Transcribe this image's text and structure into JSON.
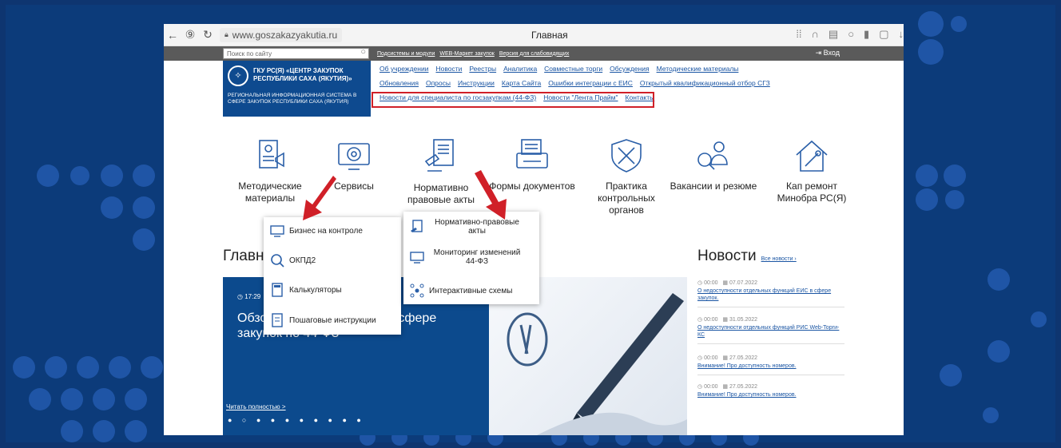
{
  "browser": {
    "url": "www.goszakazyakutia.ru",
    "page_title": "Главная"
  },
  "toolbar": {
    "search_placeholder": "Поиск по сайту",
    "links": [
      "Подсистемы и модули",
      "WEB-Маркет закупок",
      "Версия для слабовидящих"
    ],
    "login_label": "Вход"
  },
  "header": {
    "org_name": "ГКУ РС(Я) «ЦЕНТР ЗАКУПОК РЕСПУБЛИКИ САХА (ЯКУТИЯ)»",
    "org_subtitle": "РЕГИОНАЛЬНАЯ ИНФОРМАЦИОННАЯ СИСТЕМА В СФЕРЕ ЗАКУПОК РЕСПУБЛИКИ САХА (ЯКУТИЯ)",
    "nav_row1": [
      "Об учреждении",
      "Новости",
      "Реестры",
      "Аналитика",
      "Совместные торги",
      "Обсуждения",
      "Методические материалы"
    ],
    "nav_row2": [
      "Обновления",
      "Опросы",
      "Инструкции",
      "Карта Сайта",
      "Ошибки интеграции с ЕИС",
      "Открытый квалификационный отбор СГЗ"
    ],
    "nav_row3": [
      "Новости для специалиста по госзакупкам (44-ФЗ)",
      "Новости \"Лента Прайм\"",
      "Контакты"
    ]
  },
  "categories": [
    {
      "label": "Методические материалы",
      "icon": "methodical-icon"
    },
    {
      "label": "Сервисы",
      "icon": "services-gear-icon"
    },
    {
      "label": "Нормативно правовые акты",
      "icon": "legal-acts-icon"
    },
    {
      "label": "Формы документов",
      "icon": "document-forms-icon"
    },
    {
      "label": "Практика контрольных органов",
      "icon": "control-practice-icon"
    },
    {
      "label": "Вакансии и резюме",
      "icon": "vacancies-icon"
    },
    {
      "label": "Кап ремонт Минобра РС(Я)",
      "icon": "house-repair-icon"
    }
  ],
  "services_menu": [
    "Бизнес на контроле",
    "ОКПД2",
    "Калькуляторы",
    "Пошаговые инструкции"
  ],
  "legal_menu": [
    "Нормативно-правовые акты",
    "Мониторинг изменений 44-ФЗ",
    "Интерактивные схемы"
  ],
  "main": {
    "heading": "Главн",
    "hero_time": "17:29",
    "hero_title": "Обзор законодательства в сфере закупок по 44-ФЗ",
    "read_more": "Читать полностью >",
    "dots": "● ○ ● ● ● ● ● ● ● ●"
  },
  "news": {
    "heading": "Новости",
    "all_link": "Все новости ›",
    "items": [
      {
        "time": "00:00",
        "date": "07.07.2022",
        "text": "О недоступности отдельных функций ЕИС в сфере закупок."
      },
      {
        "time": "00:00",
        "date": "31.05.2022",
        "text": "О недоступности отдельных функций РИС Web-Торги-КС"
      },
      {
        "time": "00:00",
        "date": "27.05.2022",
        "text": "Внимание! Про доступность номеров."
      },
      {
        "time": "00:00",
        "date": "27.05.2022",
        "text": "Внимание! Про доступность номеров."
      }
    ]
  },
  "colors": {
    "brand_blue": "#0e4a8f",
    "highlight_red": "#d02028",
    "link_blue": "#1a55a3"
  }
}
